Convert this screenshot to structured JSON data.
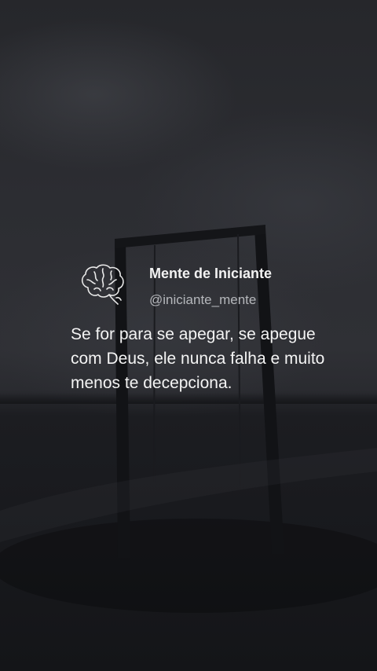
{
  "post": {
    "author_name": "Mente de Iniciante",
    "author_handle": "@iniciante_mente",
    "avatar_icon": "brain-icon",
    "text": "Se for para se apegar, se apegue com Deus, ele nunca falha e muito menos te decepciona."
  },
  "colors": {
    "text_primary": "#f4f4f4",
    "text_secondary": "#b5b7bb",
    "background": "#1b1c20"
  }
}
